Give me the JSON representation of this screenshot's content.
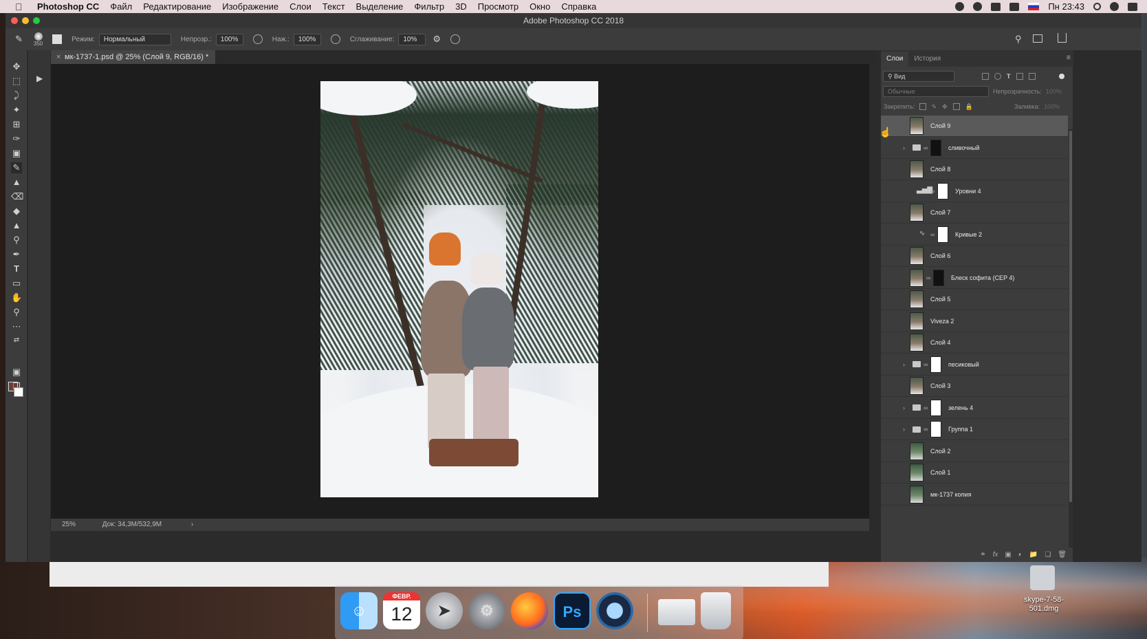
{
  "menubar": {
    "app_name": "Photoshop CC",
    "items": [
      "Файл",
      "Редактирование",
      "Изображение",
      "Слои",
      "Текст",
      "Выделение",
      "Фильтр",
      "3D",
      "Просмотр",
      "Окно",
      "Справка"
    ],
    "clock": "Пн 23:43"
  },
  "window": {
    "title": "Adobe Photoshop CC 2018"
  },
  "options": {
    "brush_size": "350",
    "mode_label": "Режим:",
    "mode_value": "Нормальный",
    "opacity_label": "Непрозр.:",
    "opacity_value": "100%",
    "flow_label": "Наж.:",
    "flow_value": "100%",
    "smoothing_label": "Сглаживание:",
    "smoothing_value": "10%"
  },
  "document": {
    "tab_title": "мк-1737-1.psd @ 25% (Слой 9, RGB/16) *",
    "zoom": "25%",
    "doc_info": "Док: 34,3M/532,9M"
  },
  "panel": {
    "tabs": [
      "Слои",
      "История"
    ],
    "filter_placeholder": "Вид",
    "blend_mode": "Обычные",
    "opacity_label": "Непрозрачность:",
    "opacity_value": "100%",
    "lock_label": "Закрепить:",
    "fill_label": "Заливка:",
    "fill_value": "100%",
    "layers": [
      {
        "name": "Слой 9",
        "kind": "pixel",
        "selected": true
      },
      {
        "name": "сливочный",
        "kind": "group",
        "mask": "dark"
      },
      {
        "name": "Слой 8",
        "kind": "pixel"
      },
      {
        "name": "Уровни 4",
        "kind": "levels"
      },
      {
        "name": "Слой 7",
        "kind": "pixel"
      },
      {
        "name": "Кривые 2",
        "kind": "curves"
      },
      {
        "name": "Слой 6",
        "kind": "pixel"
      },
      {
        "name": "Блеск софита (CEP 4)",
        "kind": "pixel-mask",
        "mask": "dark"
      },
      {
        "name": "Слой 5",
        "kind": "pixel"
      },
      {
        "name": "Viveza 2",
        "kind": "pixel"
      },
      {
        "name": "Слой 4",
        "kind": "pixel"
      },
      {
        "name": "песиковый",
        "kind": "group"
      },
      {
        "name": "Слой 3",
        "kind": "pixel"
      },
      {
        "name": "зелень 4",
        "kind": "group"
      },
      {
        "name": "Группа 1",
        "kind": "group"
      },
      {
        "name": "Слой 2",
        "kind": "pixel-green"
      },
      {
        "name": "Слой 1",
        "kind": "pixel-green"
      },
      {
        "name": "мк-1737 копия",
        "kind": "pixel-green"
      }
    ]
  },
  "dock": {
    "calendar_month": "ФЕВР.",
    "calendar_day": "12",
    "ps_label": "Ps"
  },
  "desktop": {
    "file_label": "skype-7-58-501.dmg"
  }
}
